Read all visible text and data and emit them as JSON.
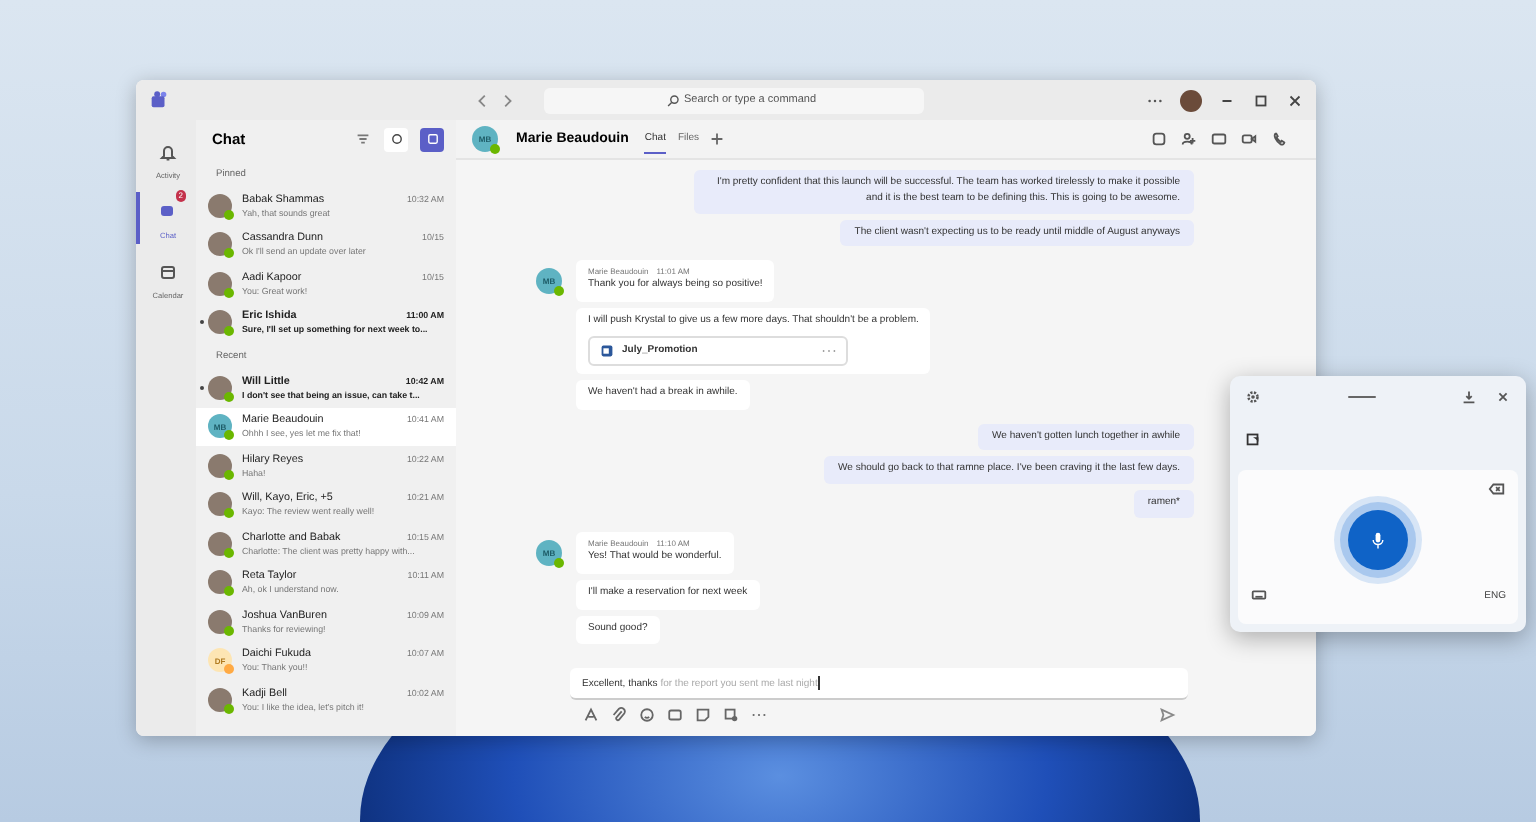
{
  "title_bar": {
    "search": {
      "placeholder": "Search or type a command"
    }
  },
  "rail": [
    {
      "label": "Activity",
      "selected": false
    },
    {
      "label": "Chat",
      "selected": true,
      "badge": "2"
    },
    {
      "label": "Calendar",
      "selected": false
    }
  ],
  "chat_list": {
    "title": "Chat",
    "sections": [
      {
        "label": "Pinned",
        "items": [
          {
            "name": "Babak Shammas",
            "preview": "Yah, that sounds great",
            "time": "10:32 AM",
            "unread": false,
            "selected": false,
            "color": "#6bb700"
          },
          {
            "name": "Cassandra Dunn",
            "preview": "Ok I'll send an update over later",
            "time": "10/15",
            "unread": false,
            "selected": false,
            "color": "#6bb700"
          },
          {
            "name": "Aadi Kapoor",
            "preview": "You: Great work!",
            "time": "10/15",
            "unread": false,
            "selected": false,
            "color": "#6bb700"
          },
          {
            "name": "Eric Ishida",
            "preview": "Sure, I'll set up something for next week to...",
            "time": "11:00 AM",
            "unread": true,
            "selected": false,
            "color": "#6bb700"
          }
        ]
      },
      {
        "label": "Recent",
        "items": [
          {
            "name": "Will Little",
            "preview": "I don't see that being an issue, can take t...",
            "time": "10:42 AM",
            "unread": true,
            "selected": false,
            "color": "#6bb700"
          },
          {
            "name": "Marie Beaudouin",
            "preview": "Ohhh I see, yes let me fix that!",
            "time": "10:41 AM",
            "unread": false,
            "selected": true,
            "initials": "MB",
            "color": "#6bb700"
          },
          {
            "name": "Hilary Reyes",
            "preview": "Haha!",
            "time": "10:22 AM",
            "unread": false,
            "selected": false,
            "color": "#6bb700"
          },
          {
            "name": "Will, Kayo, Eric, +5",
            "preview": "Kayo: The review went really well!",
            "time": "10:21 AM",
            "unread": false,
            "selected": false,
            "color": "#6bb700"
          },
          {
            "name": "Charlotte and Babak",
            "preview": "Charlotte: The client was pretty happy with...",
            "time": "10:15 AM",
            "unread": false,
            "selected": false,
            "color": "#6bb700"
          },
          {
            "name": "Reta Taylor",
            "preview": "Ah, ok I understand now.",
            "time": "10:11 AM",
            "unread": false,
            "selected": false,
            "color": "#6bb700"
          },
          {
            "name": "Joshua VanBuren",
            "preview": "Thanks for reviewing!",
            "time": "10:09 AM",
            "unread": false,
            "selected": false,
            "color": "#6bb700"
          },
          {
            "name": "Daichi Fukuda",
            "preview": "You: Thank you!!",
            "time": "10:07 AM",
            "unread": false,
            "selected": false,
            "initials": "DF",
            "color": "#ffaa44"
          },
          {
            "name": "Kadji Bell",
            "preview": "You: I like the idea, let's pitch it!",
            "time": "10:02 AM",
            "unread": false,
            "selected": false,
            "color": "#6bb700"
          }
        ]
      }
    ]
  },
  "conversation": {
    "contact": {
      "initials": "MB",
      "name": "Marie Beaudouin"
    },
    "tabs": [
      {
        "label": "Chat",
        "selected": true
      },
      {
        "label": "Files",
        "selected": false
      }
    ],
    "messages": [
      {
        "kind": "out",
        "bubbles": [
          {
            "text": "I'm pretty confident that this launch will be successful. The team has worked tirelessly to make it possible and it is the best team to be defining this. This is going to be awesome."
          },
          {
            "text": "The client wasn't expecting us to be ready until middle of August anyways"
          }
        ]
      },
      {
        "kind": "in",
        "initials": "MB",
        "sender": "Marie Beaudouin",
        "time": "11:01 AM",
        "bubbles": [
          {
            "text": "Thank you for always being so positive!"
          },
          {
            "text": "I will push Krystal to give us a few more days. That shouldn't be a problem.",
            "file": "July_Promotion"
          },
          {
            "text": "We haven't had a break in awhile."
          }
        ]
      },
      {
        "kind": "out",
        "bubbles": [
          {
            "text": "We haven't gotten lunch together in awhile"
          },
          {
            "text": "We should go back to that ramne place. I've been craving it the last few days."
          },
          {
            "text": "ramen*"
          }
        ]
      },
      {
        "kind": "in",
        "initials": "MB",
        "sender": "Marie Beaudouin",
        "time": "11:10 AM",
        "bubbles": [
          {
            "text": "Yes! That would be wonderful."
          },
          {
            "text": "I'll make a reservation for next week"
          },
          {
            "text": "Sound good?"
          }
        ]
      }
    ],
    "compose": {
      "value": "Excellent, thanks",
      "suggestion": " for the report you sent me last night"
    }
  },
  "voice_typing": {
    "language": "ENG"
  }
}
